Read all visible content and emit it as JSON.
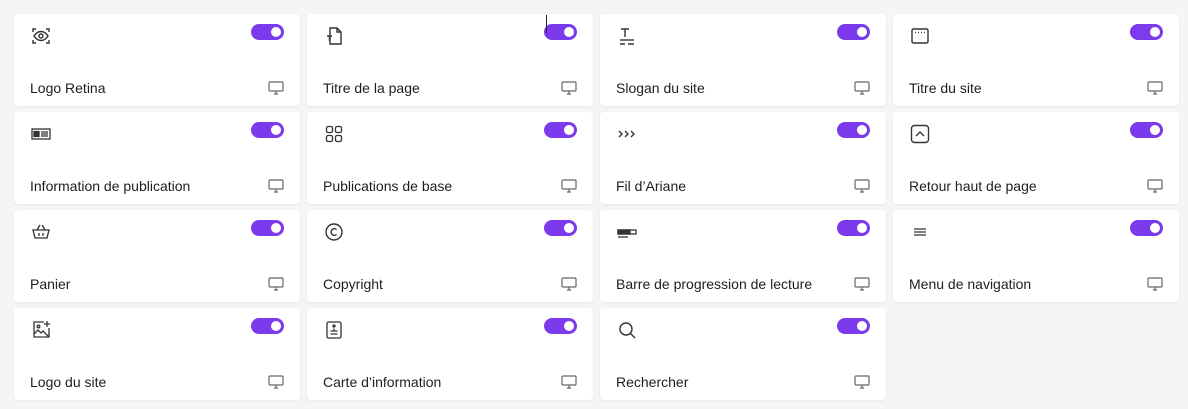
{
  "accent_color": "#7c3aed",
  "items": [
    {
      "label": "Logo Retina",
      "icon": "eye-frame-icon",
      "enabled": true,
      "device": "desktop-icon"
    },
    {
      "label": "Titre de la page",
      "icon": "page-title-icon",
      "enabled": true,
      "device": "desktop-icon"
    },
    {
      "label": "Slogan du site",
      "icon": "text-tagline-icon",
      "enabled": true,
      "device": "desktop-icon"
    },
    {
      "label": "Titre du site",
      "icon": "browser-window-icon",
      "enabled": true,
      "device": "desktop-icon"
    },
    {
      "label": "Information de publication",
      "icon": "post-info-icon",
      "enabled": true,
      "device": "desktop-icon"
    },
    {
      "label": "Publications de base",
      "icon": "grid-icon",
      "enabled": true,
      "device": "desktop-icon"
    },
    {
      "label": "Fil d’Ariane",
      "icon": "breadcrumb-icon",
      "enabled": true,
      "device": "desktop-icon"
    },
    {
      "label": "Retour haut de page",
      "icon": "back-to-top-icon",
      "enabled": true,
      "device": "desktop-icon"
    },
    {
      "label": "Panier",
      "icon": "basket-icon",
      "enabled": true,
      "device": "desktop-icon"
    },
    {
      "label": "Copyright",
      "icon": "copyright-icon",
      "enabled": true,
      "device": "desktop-icon"
    },
    {
      "label": "Barre de progression de lecture",
      "icon": "progress-bar-icon",
      "enabled": true,
      "device": "desktop-icon"
    },
    {
      "label": "Menu de navigation",
      "icon": "menu-icon",
      "enabled": true,
      "device": "desktop-icon"
    },
    {
      "label": "Logo du site",
      "icon": "image-add-icon",
      "enabled": true,
      "device": "desktop-icon"
    },
    {
      "label": "Carte d’information",
      "icon": "info-card-icon",
      "enabled": true,
      "device": "desktop-icon"
    },
    {
      "label": "Rechercher",
      "icon": "search-icon",
      "enabled": true,
      "device": "desktop-icon"
    }
  ]
}
